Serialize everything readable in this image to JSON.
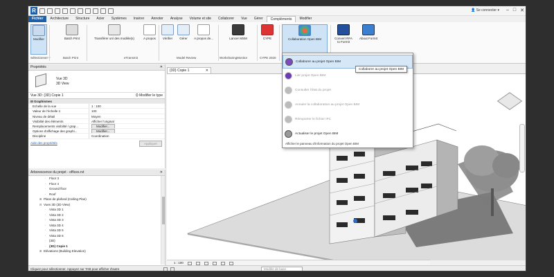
{
  "titlebar": {
    "app_logo": "R",
    "sign_in": "Se connecter"
  },
  "tabs": [
    "Fichier",
    "Architecture",
    "Structure",
    "Acier",
    "Systèmes",
    "Insérer",
    "Annoter",
    "Analyse",
    "Volume et site",
    "Collaborer",
    "Vue",
    "Gérer",
    "Compléments",
    "Modifier"
  ],
  "active_tab": "Compléments",
  "ribbon": {
    "buttons": [
      {
        "label": "Modifier"
      },
      {
        "label": "Batch Print"
      },
      {
        "label": "Transférer unì des modèle(s)"
      },
      {
        "label": "A propos"
      },
      {
        "label": "Vérifier"
      },
      {
        "label": "Gérer"
      },
      {
        "label": "A propos de..."
      },
      {
        "label": "Lancer MSM"
      },
      {
        "label": "CYPE"
      },
      {
        "label": "Collaboration Open BIM"
      },
      {
        "label": "Convert RFA to Formit"
      },
      {
        "label": "About FormIt"
      }
    ],
    "panels": [
      "Sélectionner ▾",
      "Batch Print",
      "eTransmit",
      "Model Review",
      "WorksharingMonitor",
      "CYPE 2020"
    ]
  },
  "properties": {
    "title": "Propriétés",
    "type_name": "Vue 3D",
    "type_sub": "3D View",
    "view_selector": "Vue 3D: {3D} Copie 1",
    "edit_type": "Modifier le type",
    "rows": [
      {
        "k": "Graphismes",
        "v": "",
        "hdr": true
      },
      {
        "k": "Echelle de la vue",
        "v": "1 : 100"
      },
      {
        "k": "Valeur de l'échelle   1:",
        "v": "100"
      },
      {
        "k": "Niveau de détail",
        "v": "Moyen"
      },
      {
        "k": "Visibilité des éléments",
        "v": "Afficher l'original"
      },
      {
        "k": "Remplacements visibilité / grap...",
        "v": "Modifier..."
      },
      {
        "k": "Options d'affichage des graphi...",
        "v": "Modifier..."
      },
      {
        "k": "Discipline",
        "v": "Coordination"
      }
    ],
    "help_link": "Aide des propriétés",
    "apply": "Appliquer"
  },
  "browser": {
    "title": "Arborescence du projet - offices.rvt",
    "items": [
      {
        "label": "Floor 3",
        "indent": 3,
        "tw": ""
      },
      {
        "label": "Floor 4",
        "indent": 3,
        "tw": ""
      },
      {
        "label": "Ground floor",
        "indent": 3,
        "tw": ""
      },
      {
        "label": "Roof",
        "indent": 3,
        "tw": ""
      },
      {
        "label": "Plans de plafond (Ceiling Plan)",
        "indent": 2,
        "tw": "⊞"
      },
      {
        "label": "Vues 3D (3D View)",
        "indent": 2,
        "tw": "⊟"
      },
      {
        "label": "Vista 3D 1",
        "indent": 3,
        "tw": ""
      },
      {
        "label": "Vista 3D 2",
        "indent": 3,
        "tw": ""
      },
      {
        "label": "Vista 3D 3",
        "indent": 3,
        "tw": ""
      },
      {
        "label": "Vista 3D 4",
        "indent": 3,
        "tw": ""
      },
      {
        "label": "Vista 3D 5",
        "indent": 3,
        "tw": ""
      },
      {
        "label": "Vista 3D 6",
        "indent": 3,
        "tw": ""
      },
      {
        "label": "{3D}",
        "indent": 3,
        "tw": ""
      },
      {
        "label": "{3D} Copie 1",
        "indent": 3,
        "tw": "",
        "sel": true
      },
      {
        "label": "Elévations (Building Elevation)",
        "indent": 2,
        "tw": "⊞"
      }
    ]
  },
  "view": {
    "tab_label": "{3D} Copie 1",
    "scale": "1 : 100"
  },
  "dropdown": {
    "items": [
      {
        "label": "Collaborer au projet Open BIM",
        "state": "highlight"
      },
      {
        "label": "Lier projet Open BIM",
        "state": "disabled"
      },
      {
        "label": "Consulter l'état du projet",
        "state": "disabled"
      },
      {
        "label": "Annuler la collaboration au projet Open BIM",
        "state": "disabled"
      },
      {
        "label": "Réexporter le fichier IFC",
        "state": "disabled"
      },
      {
        "label": "Actualiser le projet Open BIM",
        "state": "normal"
      }
    ],
    "footer": "Afficher le panneau d'information du projet Open BIM",
    "tooltip": "Collaborer au projet Open BIM"
  },
  "status": {
    "text": "Cliquez pour sélectionner. Appuyez sur TAB pour afficher d'autre",
    "model": "Modèle de base"
  },
  "colors": {
    "accent": "#1f5fa8",
    "highlight": "#d6e7f8"
  }
}
